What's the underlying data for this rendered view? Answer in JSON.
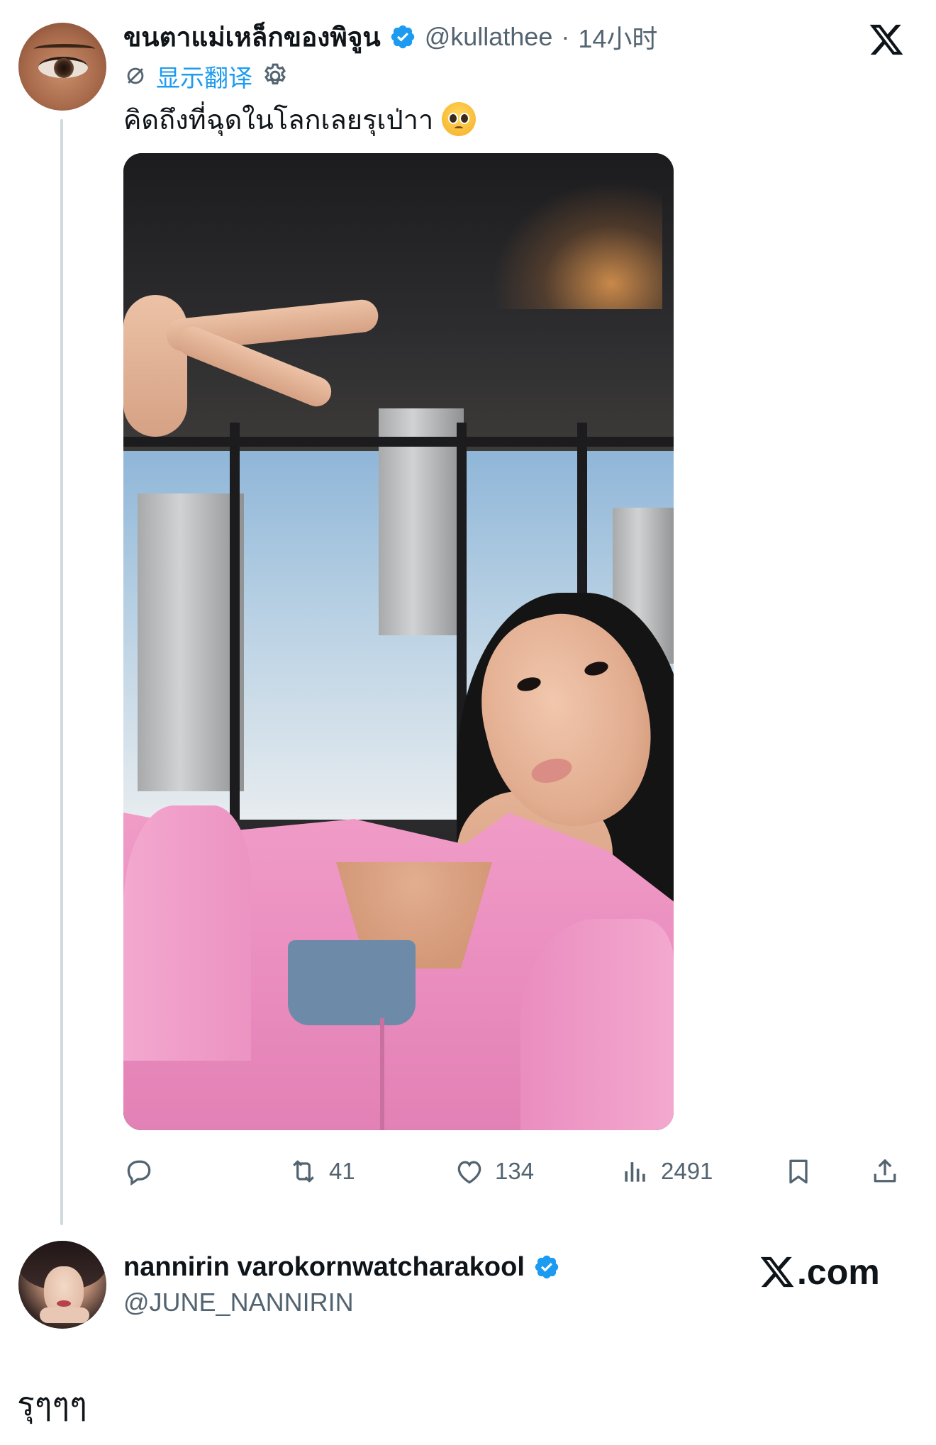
{
  "tweet": {
    "author": {
      "display_name": "ขนตาแม่เหล็กของพิจูน",
      "verified": true,
      "handle": "@kullathee",
      "separator": "·",
      "time": "14小时"
    },
    "translate_label": "显示翻译",
    "text": "คิดถึงที่ฉุดในโลกเลยรุเป่าา",
    "emoji": "pleading-face-emoji",
    "actions": {
      "reply": {
        "icon": "reply-icon",
        "count": ""
      },
      "retweet": {
        "icon": "retweet-icon",
        "count": "41"
      },
      "like": {
        "icon": "heart-icon",
        "count": "134"
      },
      "views": {
        "icon": "views-icon",
        "count": "2491"
      },
      "bookmark": {
        "icon": "bookmark-icon",
        "count": ""
      },
      "share": {
        "icon": "share-icon",
        "count": ""
      }
    }
  },
  "quote_user": {
    "display_name": "nannirin varokornwatcharakool",
    "verified": true,
    "handle": "@JUNE_NANNIRIN"
  },
  "branding": {
    "logo_icon": "x-logo-icon",
    "site_text": ".com"
  },
  "reply_text": "รุๆๆๆ",
  "colors": {
    "accent": "#1d9bf0",
    "text_primary": "#0f1419",
    "text_secondary": "#536471",
    "thread_line": "#cfd9de"
  }
}
